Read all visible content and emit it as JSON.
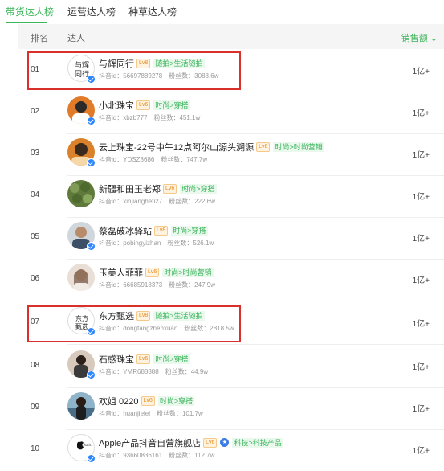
{
  "tabs": [
    "带货达人榜",
    "运营达人榜",
    "种草达人榜"
  ],
  "header": {
    "rank": "排名",
    "name": "达人",
    "sales": "销售额 ⌄"
  },
  "rows": [
    {
      "rank": "01",
      "name": "与辉同行",
      "level": "Lv8",
      "category": "随拍>生活随拍",
      "douyin_id": "抖音id：56697889278",
      "fans": "粉丝数：3088.6w",
      "sales": "1亿+"
    },
    {
      "rank": "02",
      "name": "小北珠宝",
      "level": "Lv6",
      "category": "时尚>穿搭",
      "douyin_id": "抖音id：xbzb777",
      "fans": "粉丝数：451.1w",
      "sales": "1亿+"
    },
    {
      "rank": "03",
      "name": "云上珠宝-22号中午12点阿尔山源头溯源",
      "level": "Lv6",
      "category": "时尚>时尚营销",
      "douyin_id": "抖音id：YDSZ8686",
      "fans": "粉丝数：747.7w",
      "sales": "1亿+"
    },
    {
      "rank": "04",
      "name": "新疆和田玉老郑",
      "level": "Lv6",
      "category": "时尚>穿搭",
      "douyin_id": "抖音id：xinjiangheti27",
      "fans": "粉丝数：222.6w",
      "sales": "1亿+"
    },
    {
      "rank": "05",
      "name": "蔡磊破冰驿站",
      "level": "Lv8",
      "category": "时尚>穿搭",
      "douyin_id": "抖音id：pobingyizhan",
      "fans": "粉丝数：526.1w",
      "sales": "1亿+"
    },
    {
      "rank": "06",
      "name": "玉美人菲菲",
      "level": "Lv6",
      "category": "时尚>时尚营销",
      "douyin_id": "抖音id：66685918373",
      "fans": "粉丝数：247.9w",
      "sales": "1亿+"
    },
    {
      "rank": "07",
      "name": "东方甄选",
      "level": "Lv8",
      "category": "随拍>生活随拍",
      "douyin_id": "抖音id：dongfangzhenxuan",
      "fans": "粉丝数：2818.5w",
      "sales": "1亿+"
    },
    {
      "rank": "08",
      "name": "石感珠宝",
      "level": "Lv6",
      "category": "时尚>穿搭",
      "douyin_id": "抖音id：YMR688888",
      "fans": "粉丝数：44.9w",
      "sales": "1亿+"
    },
    {
      "rank": "09",
      "name": "欢姐 0220",
      "level": "Lv6",
      "category": "时尚>穿搭",
      "douyin_id": "抖音id：huanjielei",
      "fans": "粉丝数：101.7w",
      "sales": "1亿+"
    },
    {
      "rank": "10",
      "name": "Apple产品抖音自营旗舰店",
      "level": "Lv6",
      "category": "科技>科技产品",
      "douyin_id": "抖音id：93660836161",
      "fans": "粉丝数：112.7w",
      "sales": "1亿+"
    }
  ],
  "logos": {
    "row1_avatar_text": "与辉同行",
    "row10_avatar_text": "Authorized Reseller"
  },
  "colors": {
    "accent": "#3bb55a",
    "highlight": "#d9302c",
    "level": "#e88a1a",
    "verified": "#2e86ff"
  }
}
